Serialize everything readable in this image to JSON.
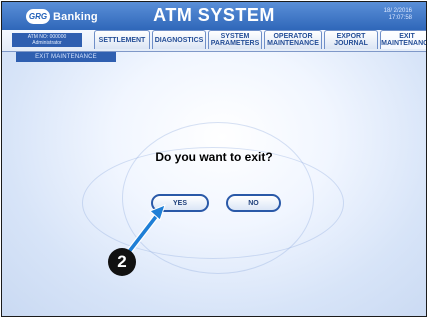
{
  "header": {
    "logo_badge": "GRG",
    "logo_text": "Banking",
    "title": "ATM SYSTEM",
    "date": "18/ 2/2016",
    "time": "17:07:58"
  },
  "info": {
    "atm_no": "ATM NO: 000000",
    "user": "Administrator"
  },
  "tabs": [
    {
      "label": "SETTLEMENT"
    },
    {
      "label": "DIAGNOSTICS"
    },
    {
      "label": "SYSTEM PARAMETERS"
    },
    {
      "label": "OPERATOR MAINTENANCE"
    },
    {
      "label": "EXPORT JOURNAL"
    },
    {
      "label": "EXIT MAINTENANCE"
    }
  ],
  "sub_tab": "EXIT MAINTENANCE",
  "dialog": {
    "question": "Do you want to exit?",
    "yes_label": "YES",
    "no_label": "NO"
  },
  "callout": {
    "number": "2",
    "color": "#1f7fd6"
  }
}
